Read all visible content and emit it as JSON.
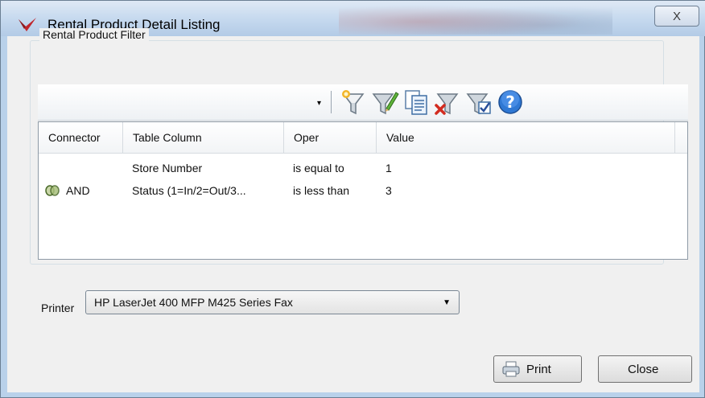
{
  "window": {
    "title": "Rental Product Detail Listing",
    "close_glyph": "X",
    "icon": "app-logo-icon"
  },
  "filter": {
    "group_label": "Rental Product Filter",
    "dropdown_value": "",
    "toolbar_icons": [
      "new-filter-icon",
      "edit-filter-icon",
      "copy-filter-icon",
      "delete-filter-icon",
      "apply-filter-icon",
      "help-icon"
    ],
    "columns": [
      "Connector",
      "Table Column",
      "Oper",
      "Value"
    ],
    "rows": [
      {
        "connector": "",
        "column": "Store Number",
        "oper": "is equal to",
        "value": "1"
      },
      {
        "connector": "AND",
        "column": "Status (1=In/2=Out/3...",
        "oper": "is less than",
        "value": "3"
      }
    ]
  },
  "printer": {
    "label": "Printer",
    "selected": "HP LaserJet 400 MFP M425 Series Fax"
  },
  "buttons": {
    "print_label": "Print",
    "close_label": "Close"
  },
  "colors": {
    "window_frame": "#b9d1ea",
    "client_background": "#f0f0f0"
  }
}
